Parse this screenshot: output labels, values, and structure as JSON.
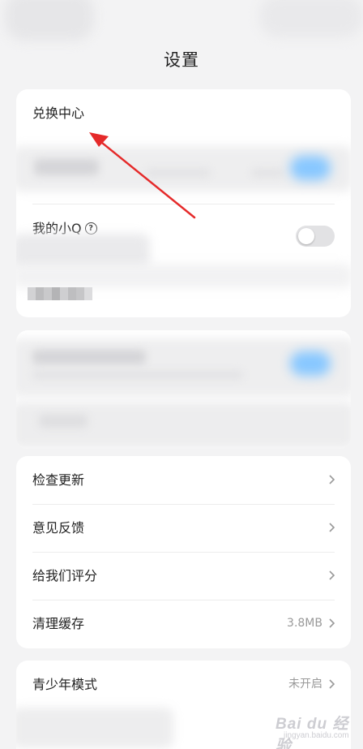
{
  "header": {
    "title": "设置"
  },
  "section_account": {
    "redeem_center": "兑换中心",
    "my_xiaoq": "我的小Q",
    "help_symbol": "?"
  },
  "section_general": {
    "check_update": "检查更新",
    "feedback": "意见反馈",
    "rate_us": "给我们评分",
    "clear_cache": "清理缓存",
    "cache_size": "3.8MB"
  },
  "section_mode": {
    "teen_mode": "青少年模式",
    "teen_mode_status": "未开启"
  },
  "toggle": {
    "my_xiaoq_on": false
  },
  "annotation": {
    "arrow_color": "#e52a2a"
  },
  "watermark": {
    "logo": "Bai du 经验",
    "url": "jingyan.baidu.com"
  }
}
